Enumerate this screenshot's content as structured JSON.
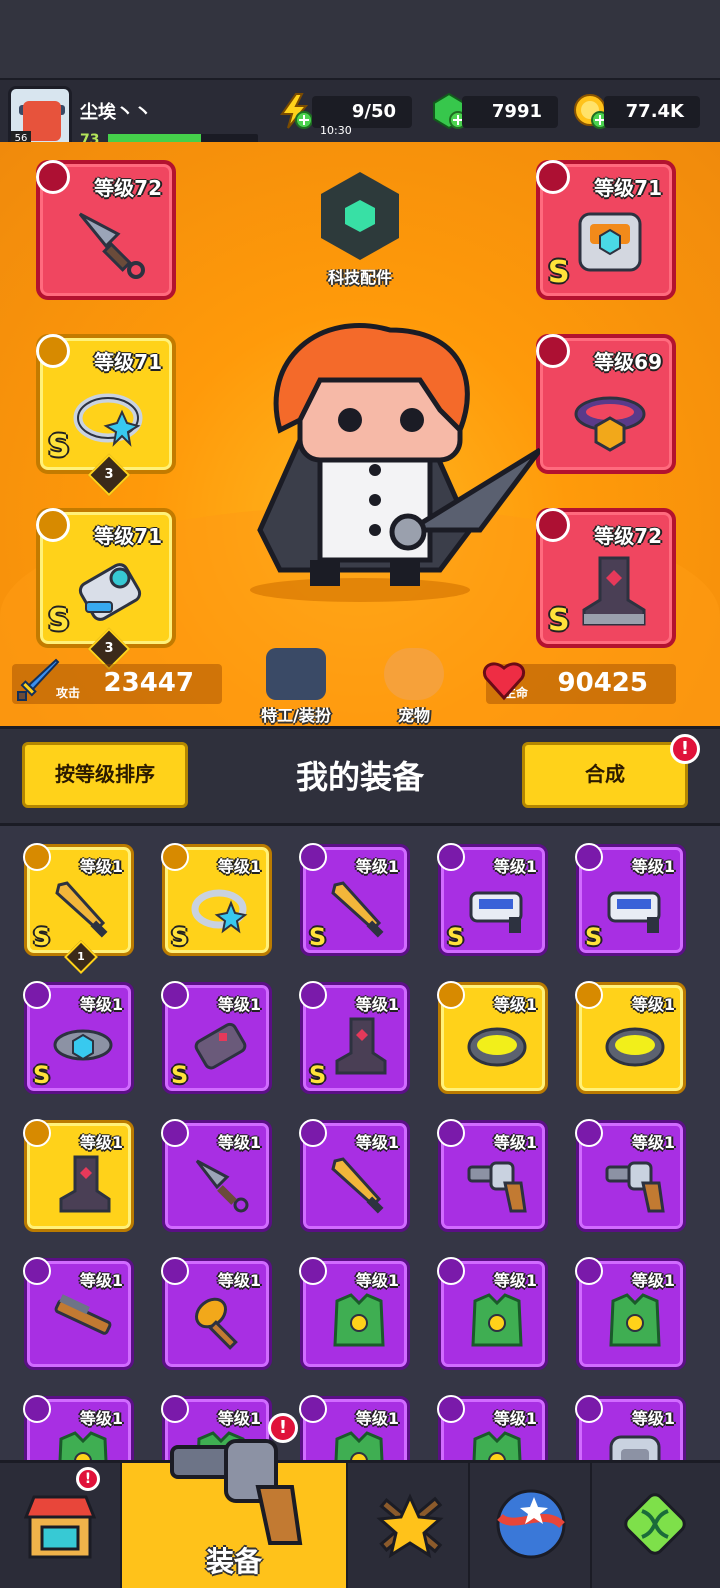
{
  "player": {
    "name": "尘埃丶丶",
    "level": "73",
    "avatar_level": "56",
    "xp_fraction": 0.62
  },
  "resources": {
    "energy": {
      "value": "9/50",
      "timer": "10:30"
    },
    "gems": {
      "value": "7991"
    },
    "coins": {
      "value": "77.4K"
    }
  },
  "tech_parts": {
    "label": "科技配件"
  },
  "equipped_slots": {
    "weapon": {
      "level": "等级72",
      "icon": "kunai-icon",
      "rarity": "red"
    },
    "armor": {
      "level": "等级71",
      "icon": "armor-icon",
      "rank": "S",
      "rarity": "red"
    },
    "ring": {
      "level": "等级71",
      "icon": "ring-icon",
      "rank": "S",
      "stars": "3",
      "rarity": "gold"
    },
    "necklace": {
      "level": "等级69",
      "icon": "belt-icon",
      "rarity": "red"
    },
    "glove": {
      "level": "等级71",
      "icon": "gauntlet-icon",
      "rank": "S",
      "stars": "3",
      "rarity": "gold"
    },
    "boots": {
      "level": "等级72",
      "icon": "boot-icon",
      "rank": "S",
      "rarity": "red"
    }
  },
  "stats": {
    "attack": {
      "label": "攻击",
      "value": "23447"
    },
    "hp": {
      "label": "生命",
      "value": "90425"
    }
  },
  "hero_buttons": {
    "agent_label": "特工/装扮",
    "pet_label": "宠物"
  },
  "toolbar": {
    "sort_label": "按等级排序",
    "title": "我的装备",
    "merge_label": "合成",
    "merge_alert": "!"
  },
  "inventory": [
    {
      "level": "等级1",
      "rarity": "gold",
      "rank": "S",
      "stars": "1",
      "icon": "sword-icon"
    },
    {
      "level": "等级1",
      "rarity": "gold",
      "rank": "S",
      "icon": "ring-icon"
    },
    {
      "level": "等级1",
      "rarity": "purple",
      "rank": "S",
      "icon": "sword-icon"
    },
    {
      "level": "等级1",
      "rarity": "purple",
      "rank": "S",
      "icon": "blaster-icon"
    },
    {
      "level": "等级1",
      "rarity": "purple",
      "rank": "S",
      "icon": "blaster-icon"
    },
    {
      "level": "等级1",
      "rarity": "purple",
      "rank": "S",
      "icon": "belt-icon"
    },
    {
      "level": "等级1",
      "rarity": "purple",
      "rank": "S",
      "icon": "gauntlet-icon"
    },
    {
      "level": "等级1",
      "rarity": "purple",
      "rank": "S",
      "icon": "boot-icon"
    },
    {
      "level": "等级1",
      "rarity": "gold",
      "icon": "collar-icon"
    },
    {
      "level": "等级1",
      "rarity": "gold",
      "icon": "collar-icon"
    },
    {
      "level": "等级1",
      "rarity": "gold",
      "icon": "boot-icon"
    },
    {
      "level": "等级1",
      "rarity": "purple",
      "icon": "kunai-icon"
    },
    {
      "level": "等级1",
      "rarity": "purple",
      "icon": "sword-icon"
    },
    {
      "level": "等级1",
      "rarity": "purple",
      "icon": "revolver-icon"
    },
    {
      "level": "等级1",
      "rarity": "purple",
      "icon": "revolver-icon"
    },
    {
      "level": "等级1",
      "rarity": "purple",
      "icon": "shotgun-icon"
    },
    {
      "level": "等级1",
      "rarity": "purple",
      "icon": "club-icon"
    },
    {
      "level": "等级1",
      "rarity": "purple",
      "icon": "vest-icon"
    },
    {
      "level": "等级1",
      "rarity": "purple",
      "icon": "vest-icon"
    },
    {
      "level": "等级1",
      "rarity": "purple",
      "icon": "vest-icon"
    },
    {
      "level": "等级1",
      "rarity": "purple",
      "icon": "vest-icon"
    },
    {
      "level": "等级1",
      "rarity": "purple",
      "icon": "vest-icon"
    },
    {
      "level": "等级1",
      "rarity": "purple",
      "icon": "vest-icon"
    },
    {
      "level": "等级1",
      "rarity": "purple",
      "icon": "vest-icon"
    },
    {
      "level": "等级1",
      "rarity": "purple",
      "icon": "armor-icon"
    }
  ],
  "bottom_nav": [
    {
      "icon": "shop-icon",
      "alert": "!"
    },
    {
      "label": "装备",
      "icon": "revolver-icon",
      "alert": "!",
      "active": true
    },
    {
      "icon": "battle-star-icon"
    },
    {
      "icon": "orb-icon"
    },
    {
      "icon": "dna-icon"
    }
  ],
  "colors": {
    "accent": "#ffd21a",
    "panel_orange": "#ff9a0a",
    "rarity_red": "#f04660",
    "rarity_purple": "#a82fe3",
    "rarity_gold": "#ffd21a"
  }
}
